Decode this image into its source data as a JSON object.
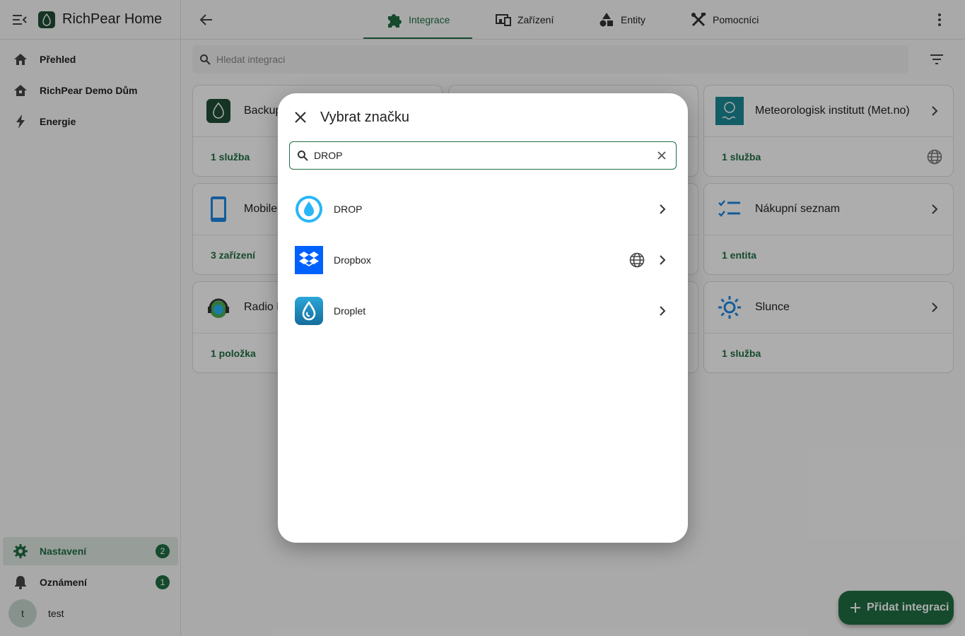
{
  "app": {
    "title": "RichPear Home"
  },
  "sidebar": {
    "items": [
      {
        "label": "Přehled",
        "icon": "home-icon"
      },
      {
        "label": "RichPear Demo Dům",
        "icon": "home-outline-icon"
      },
      {
        "label": "Energie",
        "icon": "lightning-icon"
      }
    ],
    "settings": {
      "label": "Nastavení",
      "badge": "2"
    },
    "notifications": {
      "label": "Oznámení",
      "badge": "1"
    },
    "user": {
      "initial": "t",
      "name": "test"
    }
  },
  "tabs": [
    {
      "label": "Integrace",
      "icon": "puzzle-icon",
      "active": true
    },
    {
      "label": "Zařízení",
      "icon": "devices-icon",
      "active": false
    },
    {
      "label": "Entity",
      "icon": "shapes-icon",
      "active": false
    },
    {
      "label": "Pomocníci",
      "icon": "tools-icon",
      "active": false
    }
  ],
  "search": {
    "placeholder": "Hledat integraci"
  },
  "cards": [
    {
      "title": "Backup",
      "link": "1 služba",
      "icon": "backup-logo"
    },
    {
      "title": "Meteorologisk institutt (Met.no)",
      "link": "1 služba",
      "icon": "metno-logo",
      "cloud": true
    },
    {
      "title": "Mobile App",
      "link": "3 zařízení",
      "icon": "phone-icon"
    },
    {
      "title": "Nákupní seznam",
      "link": "1 entita",
      "icon": "checklist-icon"
    },
    {
      "title": "Radio Browser",
      "link": "1 položka",
      "icon": "radio-logo"
    },
    {
      "title": "Slunce",
      "link": "1 služba",
      "icon": "sun-icon"
    }
  ],
  "dialog": {
    "title": "Vybrat značku",
    "search_value": "DROP",
    "brands": [
      {
        "name": "DROP",
        "icon": "drop-logo",
        "cloud": false
      },
      {
        "name": "Dropbox",
        "icon": "dropbox-logo",
        "cloud": true
      },
      {
        "name": "Droplet",
        "icon": "droplet-logo",
        "cloud": false
      }
    ]
  },
  "fab": {
    "label": "Přidat integraci"
  },
  "colors": {
    "accent": "#1f6e43",
    "scrim": "rgba(0,0,0,0.32)"
  }
}
